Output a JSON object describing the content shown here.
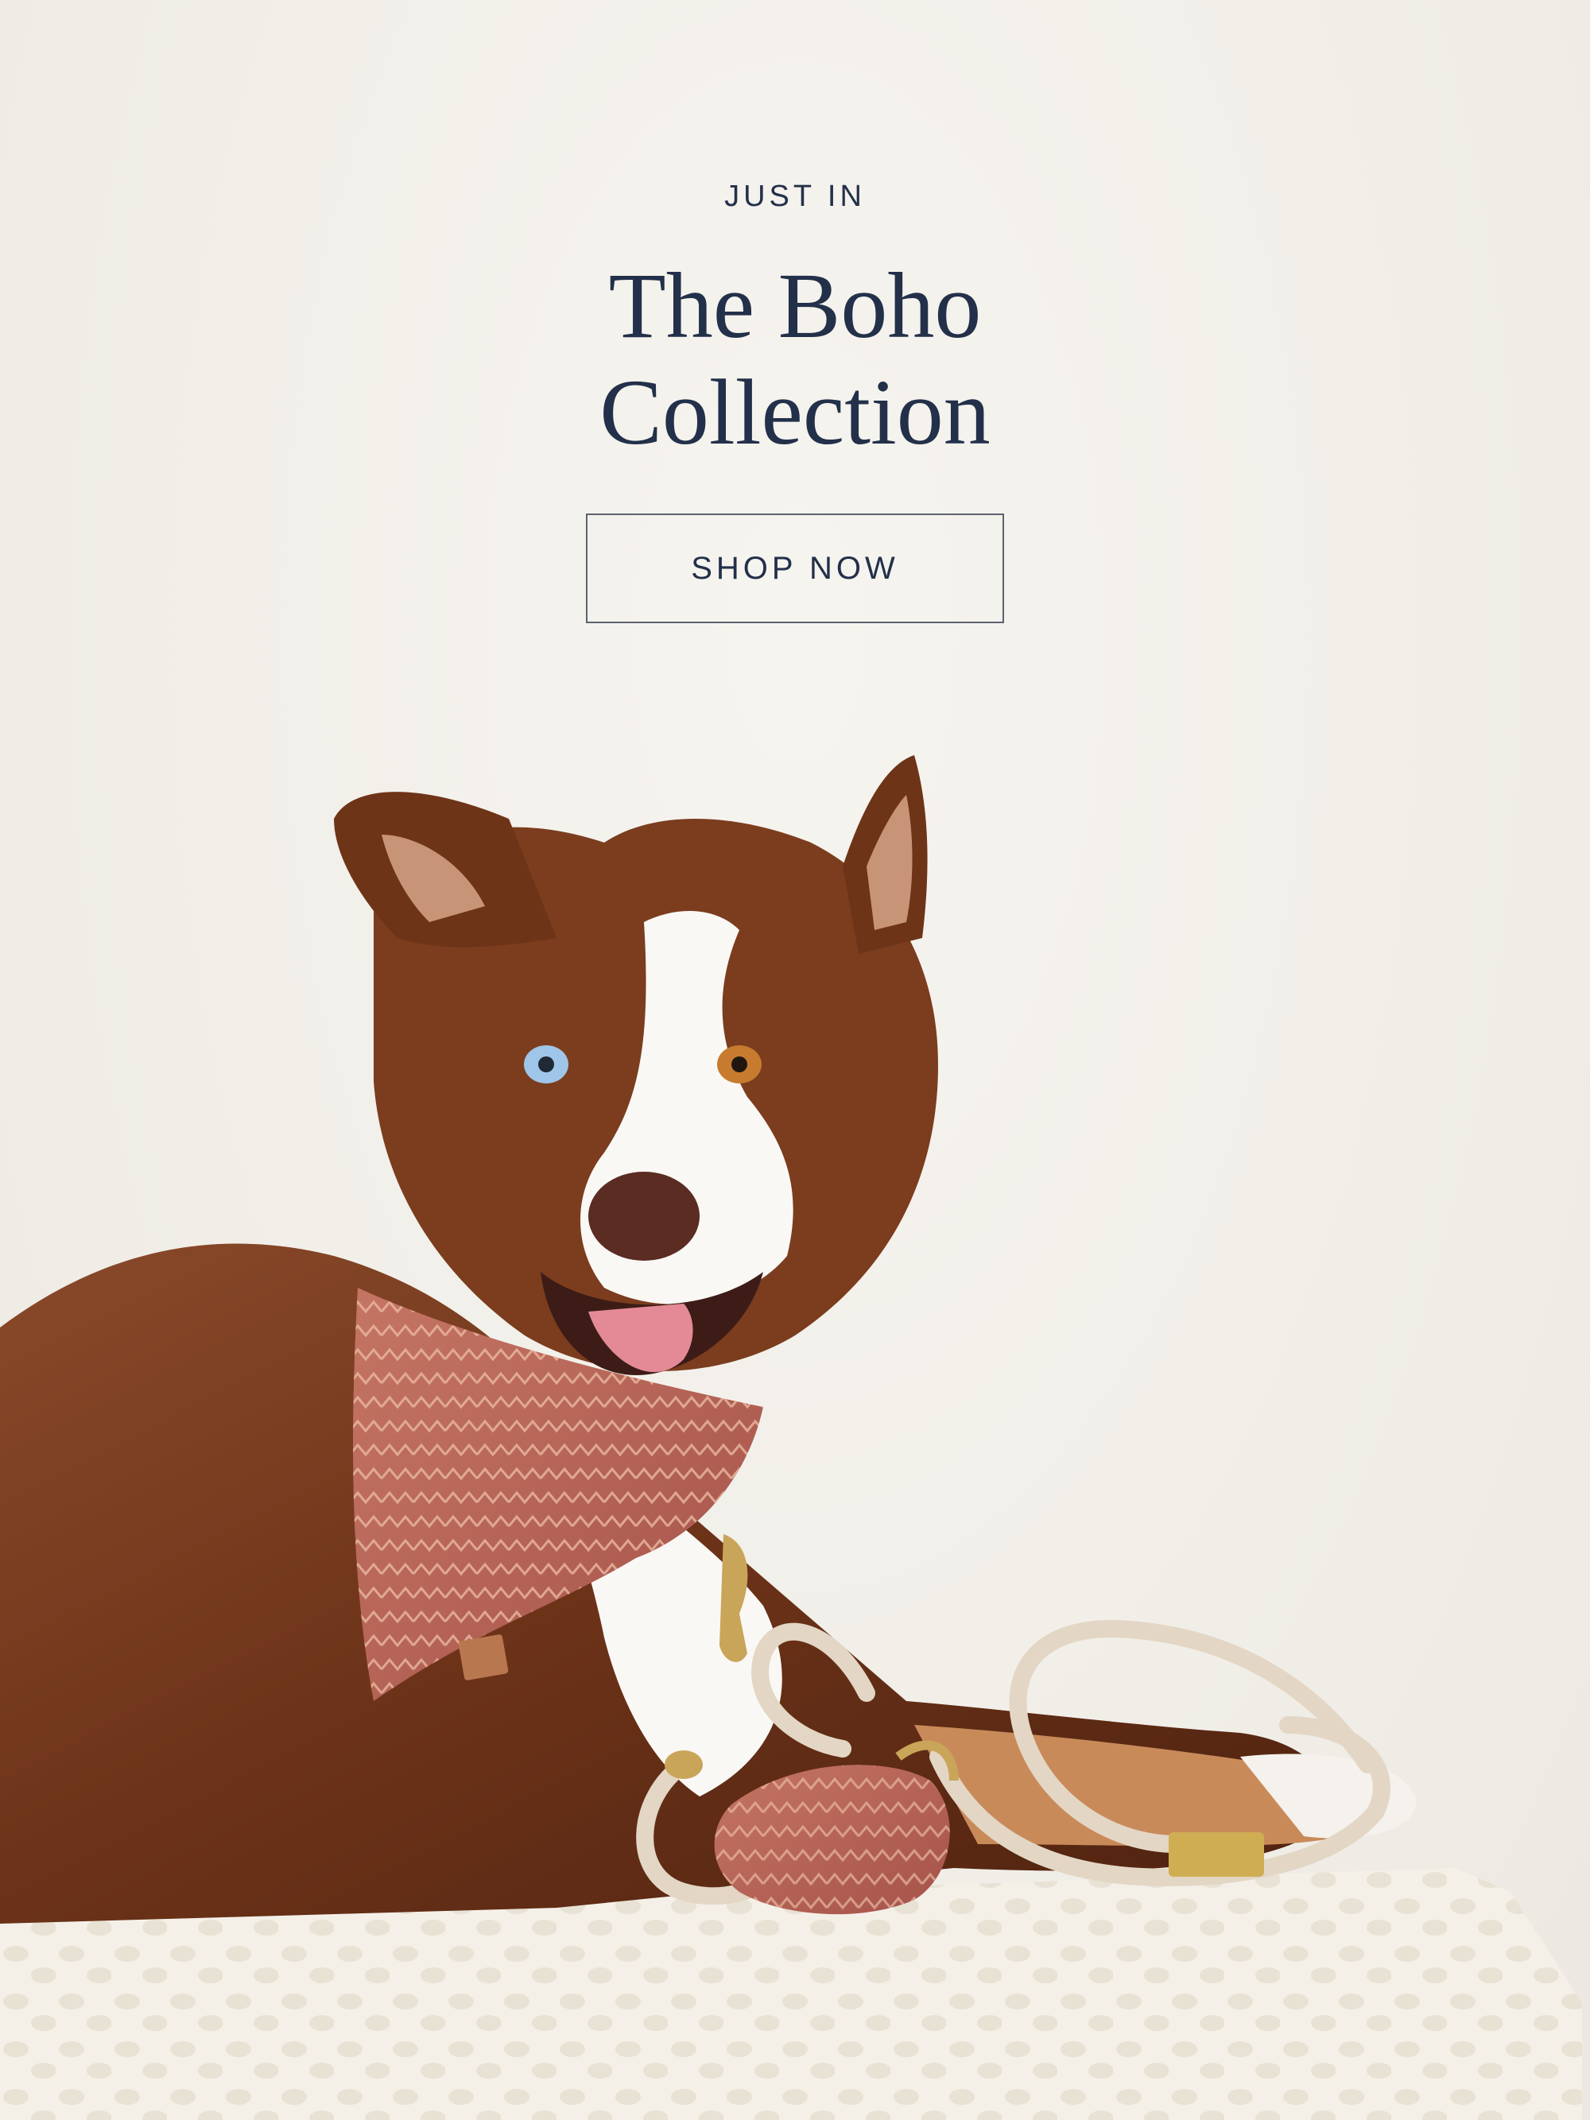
{
  "hero": {
    "eyebrow": "JUST IN",
    "title_line1": "The Boho",
    "title_line2": "Collection",
    "cta_label": "SHOP NOW"
  },
  "colors": {
    "background": "#f2efe9",
    "text": "#23304a",
    "button_border": "#5c6271"
  },
  "image": {
    "icon": "dog-photo"
  }
}
